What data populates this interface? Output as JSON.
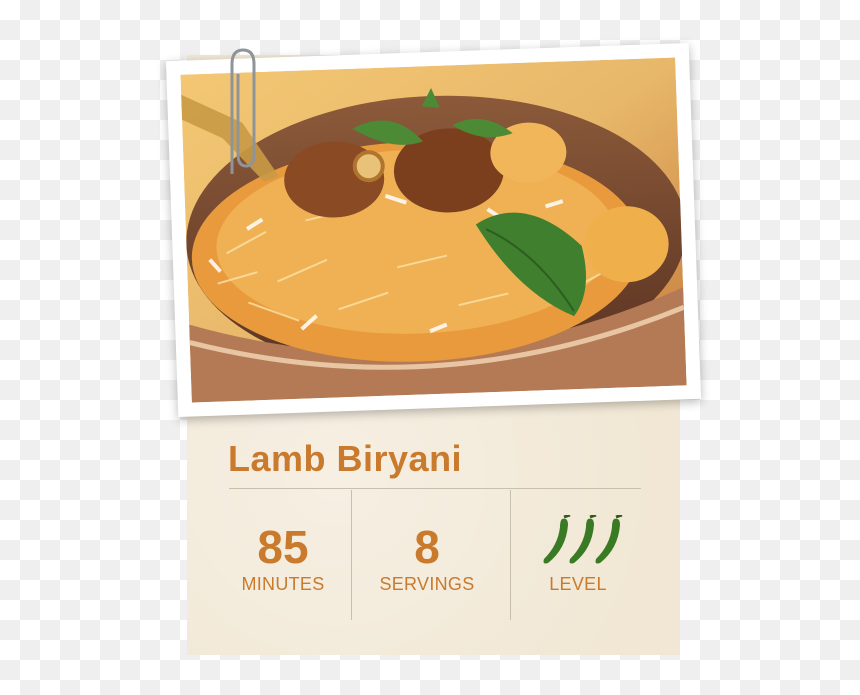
{
  "recipe": {
    "title": "Lamb Biryani",
    "photo_icon": "biryani-photo"
  },
  "stats": [
    {
      "value": "85",
      "label": "MINUTES"
    },
    {
      "value": "8",
      "label": "SERVINGS"
    },
    {
      "value": "",
      "label": "LEVEL",
      "icon": "chili-pepper-icon",
      "level": 3
    }
  ],
  "colors": {
    "accent": "#c97a2c",
    "card": "#f1e7d4",
    "divider": "#c9bfae",
    "pepper": "#3a7a24"
  }
}
